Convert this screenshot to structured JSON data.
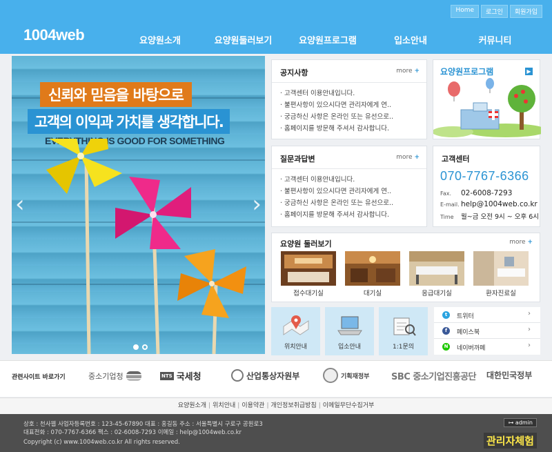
{
  "header": {
    "top_links": [
      "Home",
      "로그인",
      "회원가입"
    ],
    "logo": "1004web",
    "nav": [
      "요양원소개",
      "요양원둘러보기",
      "요양원프로그램",
      "입소안내",
      "커뮤니티"
    ]
  },
  "banner": {
    "caption1": "신뢰와 믿음을 바탕으로",
    "caption2": "고객의 이익과 가치를 생각합니다.",
    "caption3": "EVERYTHING IS GOOD FOR SOMETHING",
    "prev": "‹",
    "next": "›"
  },
  "notice": {
    "title": "공지사항",
    "more": "more",
    "items": [
      "고객센터 이용안내입니다.",
      "불편사항이 있으시다면 관리자에게 연..",
      "궁금하신 사항은 온라인 또는 유선으로..",
      "홈페이지를 방문해 주셔서 감사합니다."
    ]
  },
  "qna": {
    "title": "질문과답변",
    "more": "more",
    "items": [
      "고객센터 이용안내입니다.",
      "불편사항이 있으시다면 관리자에게 연..",
      "궁금하신 사항은 온라인 또는 유선으로..",
      "홈페이지를 방문해 주셔서 감사합니다."
    ]
  },
  "program": {
    "title": "요양원프로그램"
  },
  "customer_center": {
    "title": "고객센터",
    "phone": "070-7767-6366",
    "fax_label": "Fax.",
    "fax": "02-6008-7293",
    "email_label": "E-mail.",
    "email": "help@1004web.co.kr",
    "time_label": "Time",
    "time": "월~금 오전 9시 ~ 오후 6시"
  },
  "tour": {
    "title": "요양원 둘러보기",
    "more": "more",
    "items": [
      "접수대기실",
      "대기실",
      "응급대기실",
      "환자진료실"
    ]
  },
  "quick": [
    "위치안내",
    "입소안내",
    "1:1문의"
  ],
  "sns": [
    {
      "label": "트위터",
      "icon": "twitter-icon",
      "color": "#2aa3e0"
    },
    {
      "label": "페이스북",
      "icon": "facebook-icon",
      "color": "#3b5998"
    },
    {
      "label": "네이버까페",
      "icon": "naver-icon",
      "color": "#1ec800"
    }
  ],
  "related": {
    "title": "관련사이트 바로가기",
    "sites": [
      "중소기업청",
      "국세청",
      "산업통상자원부",
      "기획재정부",
      "SBC 중소기업진흥공단",
      "대한민국정부"
    ]
  },
  "footer_links": [
    "요양원소개",
    "위치안내",
    "이용약관",
    "개인정보취급방침",
    "이메일무단수집거부"
  ],
  "footer": {
    "line1": "상호 : 천사웹   사업자등록번호 : 123-45-67890  대표 : 홍길동  주소 : 서울특별시 구로구 공원로3",
    "line2": "대표전화 : 070-7767-6366  팩스 : 02-6008-7293  이메일 : help@1004web.co.kr",
    "copyright": "Copyright (c) www.1004web.co.kr All rights reserved.",
    "admin": "admin",
    "admin_experience": "관리자체험"
  }
}
